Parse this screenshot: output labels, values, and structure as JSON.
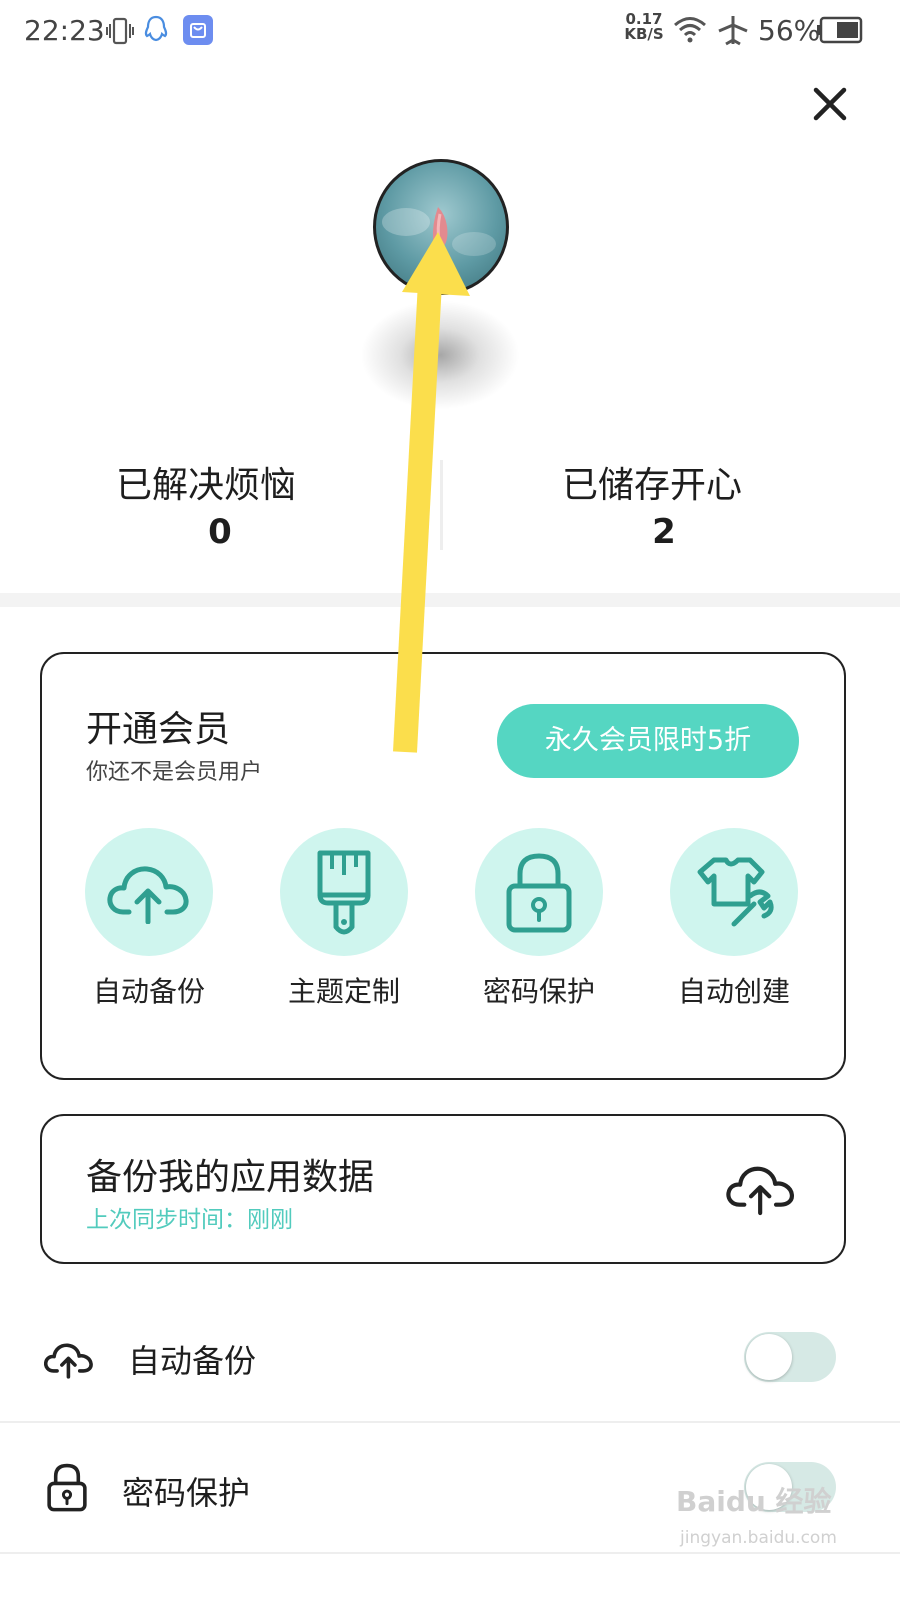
{
  "status_bar": {
    "time": "22:23",
    "speed_value": "0.17",
    "speed_unit": "KB/S",
    "battery_percent": "56%",
    "icons": [
      "vibrate-icon",
      "qq-icon",
      "store-icon",
      "wifi-icon",
      "airplane-icon",
      "battery-icon"
    ]
  },
  "header": {
    "close_icon": "close-icon"
  },
  "profile": {
    "stats": [
      {
        "label": "已解决烦恼",
        "value": "0"
      },
      {
        "label": "已储存开心",
        "value": "2"
      }
    ]
  },
  "membership": {
    "title": "开通会员",
    "subtitle": "你还不是会员用户",
    "promo_button": "永久会员限时5折",
    "features": [
      {
        "label": "自动备份",
        "icon": "cloud-upload-icon"
      },
      {
        "label": "主题定制",
        "icon": "paint-brush-icon"
      },
      {
        "label": "密码保护",
        "icon": "lock-icon"
      },
      {
        "label": "自动创建",
        "icon": "shirt-wrench-icon"
      }
    ]
  },
  "backup": {
    "title": "备份我的应用数据",
    "subtitle": "上次同步时间：刚刚",
    "icon": "cloud-upload-icon"
  },
  "settings": [
    {
      "label": "自动备份",
      "icon": "cloud-upload-icon",
      "enabled": false
    },
    {
      "label": "密码保护",
      "icon": "lock-icon",
      "enabled": false
    }
  ],
  "watermark": {
    "brand": "Baidu 经验",
    "url": "jingyan.baidu.com"
  },
  "colors": {
    "accent": "#55d6c2",
    "accent_light": "#cff5ee",
    "accent_text": "#52cbbd",
    "arrow": "#fbde4c",
    "toggle_off": "#d6e9e5"
  }
}
